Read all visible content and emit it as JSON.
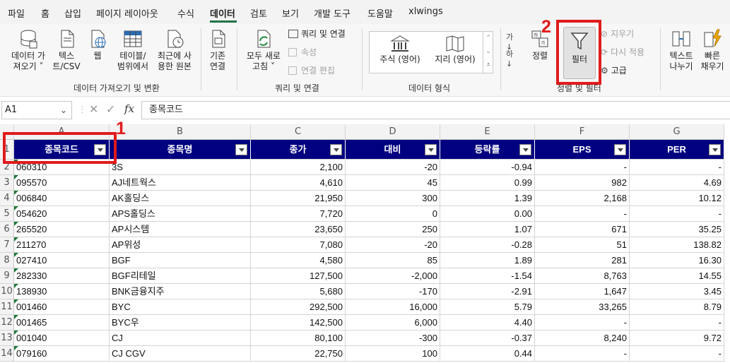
{
  "menu": {
    "items": [
      "파일",
      "홈",
      "삽입",
      "페이지 레이아웃",
      "수식",
      "데이터",
      "검토",
      "보기",
      "개발 도구",
      "도움말",
      "xlwings"
    ],
    "active": "데이터"
  },
  "ribbon": {
    "get_data": "데이터 가\n져오기 ˅",
    "text_csv": "텍스\n트/CSV",
    "web": "웹",
    "table_range": "테이블/\n범위에서",
    "recent_sources": "최근에 사\n용한 원본",
    "existing_conn": "기존\n연결",
    "group_get_transform": "데이터 가져오기 및 변환",
    "refresh_all": "모두 새로\n고침 ˅",
    "queries_connections": "쿼리 및 연결",
    "properties": "속성",
    "edit_links": "연결 편집",
    "group_queries": "쿼리 및 연결",
    "stocks": "주식 (영어)",
    "geography": "지리 (영어)",
    "group_data_types": "데이터 형식",
    "sort": "정렬",
    "filter": "필터",
    "clear": "지우기",
    "reapply": "다시 적용",
    "advanced": "고급",
    "group_sort_filter": "정렬 및 필터",
    "text_to_columns": "텍스트\n나누기",
    "flash_fill": "빠른\n채우기"
  },
  "formula_bar": {
    "name_box": "A1",
    "fx": "fx",
    "content": "종목코드"
  },
  "sheet": {
    "columns": [
      "A",
      "B",
      "C",
      "D",
      "E",
      "F",
      "G"
    ],
    "headers": [
      "종목코드",
      "종목명",
      "종가",
      "대비",
      "등락률",
      "EPS",
      "PER"
    ],
    "rows": [
      [
        "060310",
        "3S",
        "2,100",
        "-20",
        "-0.94",
        "-",
        "-"
      ],
      [
        "095570",
        "AJ네트웍스",
        "4,610",
        "45",
        "0.99",
        "982",
        "4.69"
      ],
      [
        "006840",
        "AK홀딩스",
        "21,950",
        "300",
        "1.39",
        "2,168",
        "10.12"
      ],
      [
        "054620",
        "APS홀딩스",
        "7,720",
        "0",
        "0.00",
        "-",
        "-"
      ],
      [
        "265520",
        "AP시스템",
        "23,650",
        "250",
        "1.07",
        "671",
        "35.25"
      ],
      [
        "211270",
        "AP위성",
        "7,080",
        "-20",
        "-0.28",
        "51",
        "138.82"
      ],
      [
        "027410",
        "BGF",
        "4,580",
        "85",
        "1.89",
        "281",
        "16.30"
      ],
      [
        "282330",
        "BGF리테일",
        "127,500",
        "-2,000",
        "-1.54",
        "8,763",
        "14.55"
      ],
      [
        "138930",
        "BNK금융지주",
        "5,680",
        "-170",
        "-2.91",
        "1,647",
        "3.45"
      ],
      [
        "001460",
        "BYC",
        "292,500",
        "16,000",
        "5.79",
        "33,265",
        "8.79"
      ],
      [
        "001465",
        "BYC우",
        "142,500",
        "6,000",
        "4.40",
        "-",
        "-"
      ],
      [
        "001040",
        "CJ",
        "80,100",
        "-300",
        "-0.37",
        "8,240",
        "9.72"
      ],
      [
        "079160",
        "CJ CGV",
        "22,750",
        "100",
        "0.44",
        "-",
        "-"
      ]
    ]
  },
  "annotations": {
    "label1": "1",
    "label2": "2",
    "color": "#e01b1b"
  }
}
